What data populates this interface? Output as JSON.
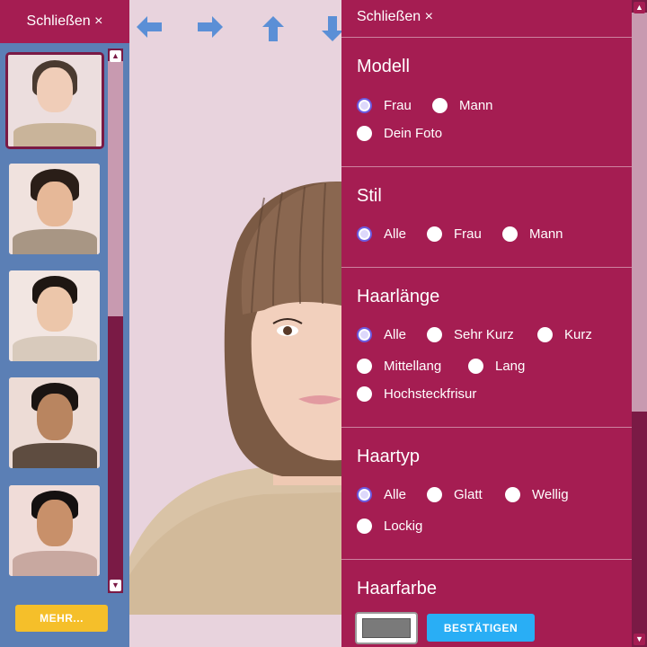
{
  "left_panel": {
    "close_label": "Schließen ×",
    "more_label": "MEHR..."
  },
  "toolbar": {
    "arrows": [
      "arrow-left-icon",
      "arrow-right-icon",
      "arrow-up-icon",
      "arrow-down-icon"
    ]
  },
  "right_panel": {
    "close_label": "Schließen ×",
    "sections": {
      "modell": {
        "title": "Modell",
        "options": [
          "Frau",
          "Mann",
          "Dein Foto"
        ],
        "selected": "Frau"
      },
      "stil": {
        "title": "Stil",
        "options": [
          "Alle",
          "Frau",
          "Mann"
        ],
        "selected": "Alle"
      },
      "haarlaenge": {
        "title": "Haarlänge",
        "options": [
          "Alle",
          "Sehr Kurz",
          "Kurz",
          "Mittellang",
          "Lang",
          "Hochsteckfrisur"
        ],
        "selected": "Alle"
      },
      "haartyp": {
        "title": "Haartyp",
        "options": [
          "Alle",
          "Glatt",
          "Wellig",
          "Lockig"
        ],
        "selected": "Alle"
      },
      "haarfarbe": {
        "title": "Haarfarbe",
        "confirm_label": "BESTÄTIGEN",
        "swatch_color": "#7a7a7a"
      }
    }
  },
  "colors": {
    "accent": "#a51d52",
    "sidebar_bg": "#5b7fb5",
    "more_button": "#f5bf2a",
    "confirm_button": "#29aef5",
    "radio_checked": "#6b5be0"
  }
}
